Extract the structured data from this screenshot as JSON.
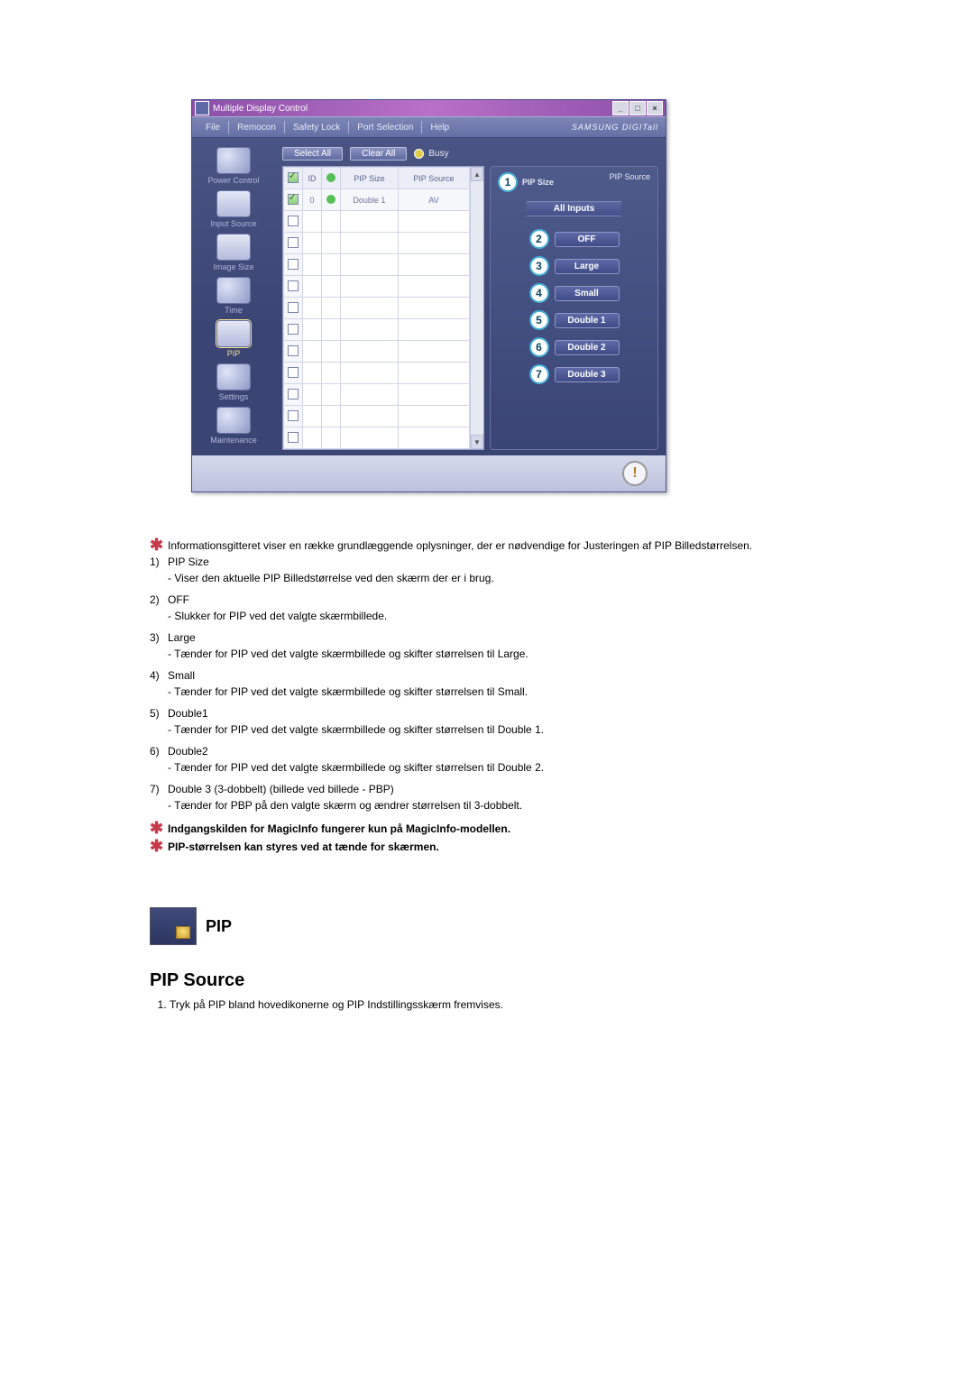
{
  "app": {
    "title": "Multiple Display Control",
    "brand": "SAMSUNG DIGITall",
    "window_buttons": {
      "min": "_",
      "max": "□",
      "close": "×"
    }
  },
  "menu": {
    "items": [
      "File",
      "Remocon",
      "Safety Lock",
      "Port Selection",
      "Help"
    ]
  },
  "sidebar": {
    "items": [
      {
        "label": "Power Control"
      },
      {
        "label": "Input Source"
      },
      {
        "label": "Image Size"
      },
      {
        "label": "Time"
      },
      {
        "label": "PIP",
        "active": true
      },
      {
        "label": "Settings"
      },
      {
        "label": "Maintenance"
      }
    ]
  },
  "toolbar": {
    "select_all": "Select All",
    "clear_all": "Clear All",
    "busy": "Busy"
  },
  "grid": {
    "headers": {
      "id": "ID",
      "power_icon": "⏻",
      "pip_size": "PIP Size",
      "pip_source": "PIP Source"
    },
    "row": {
      "id": "0",
      "pip_size": "Double 1",
      "pip_source": "AV"
    }
  },
  "panel": {
    "col1": "PIP Size",
    "col2": "PIP Source",
    "all_inputs": "All Inputs",
    "options": [
      {
        "n": "2",
        "label": "OFF"
      },
      {
        "n": "3",
        "label": "Large"
      },
      {
        "n": "4",
        "label": "Small"
      },
      {
        "n": "5",
        "label": "Double 1"
      },
      {
        "n": "6",
        "label": "Double 2"
      },
      {
        "n": "7",
        "label": "Double 3"
      }
    ],
    "callout1": "1"
  },
  "status": {
    "caution": "!"
  },
  "desc": {
    "intro": "Informationsgitteret viser en række grundlæggende oplysninger, der er nødvendige for Justeringen af PIP Billedstørrelsen.",
    "items": [
      {
        "n": "1)",
        "title": "PIP Size",
        "sub": "- Viser den aktuelle PIP Billedstørrelse ved den skærm der er i brug."
      },
      {
        "n": "2)",
        "title": "OFF",
        "sub": "- Slukker for PIP ved det valgte skærmbillede."
      },
      {
        "n": "3)",
        "title": "Large",
        "sub": "- Tænder for PIP ved det valgte skærmbillede og skifter størrelsen til Large."
      },
      {
        "n": "4)",
        "title": "Small",
        "sub": "- Tænder for PIP ved det valgte skærmbillede og skifter størrelsen til Small."
      },
      {
        "n": "5)",
        "title": "Double1",
        "sub": "- Tænder for PIP ved det valgte skærmbillede og skifter størrelsen til Double 1."
      },
      {
        "n": "6)",
        "title": "Double2",
        "sub": "- Tænder for PIP ved det valgte skærmbillede og skifter størrelsen til Double 2."
      },
      {
        "n": "7)",
        "title": "Double 3 (3-dobbelt) (billede ved billede - PBP)",
        "sub": "- Tænder for PBP på den valgte skærm og ændrer størrelsen til 3-dobbelt."
      }
    ],
    "notes": [
      "Indgangskilden for MagicInfo fungerer kun på MagicInfo-modellen.",
      "PIP-størrelsen kan styres ved at tænde for skærmen."
    ]
  },
  "section": {
    "pip_label": "PIP",
    "source_heading": "PIP Source",
    "source_item1": "Tryk på PIP bland hovedikonerne og PIP Indstillingsskærm fremvises."
  }
}
